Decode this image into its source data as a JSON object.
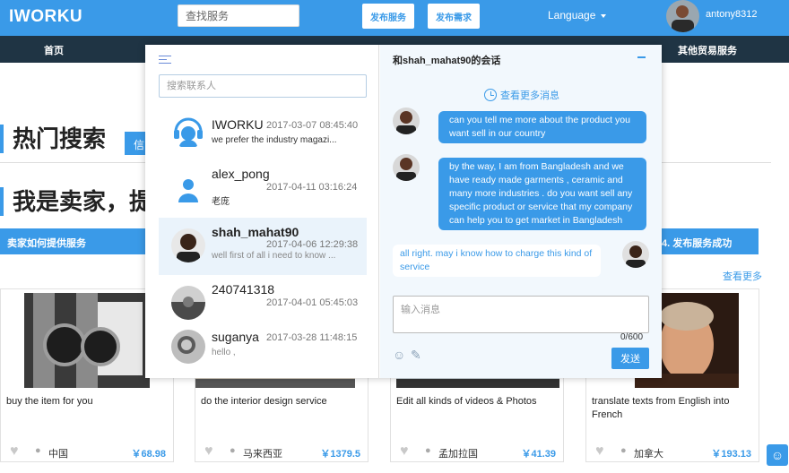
{
  "header": {
    "logo": "IWORKU",
    "search_placeholder": "查找服务",
    "publish_service": "发布服务",
    "publish_demand": "发布需求",
    "language": "Language",
    "username": "antony8312"
  },
  "nav": {
    "items": [
      "首页",
      "其他贸易服务"
    ]
  },
  "page": {
    "hot_search_title": "热门搜索",
    "hot_tag_partial": "信",
    "seller_title_partial": "我是卖家，提",
    "seller_howto": "卖家如何提供服务",
    "step4_partial": "4. 发布服务成功",
    "view_more": "查看更多"
  },
  "cards": [
    {
      "title": "buy the item for you",
      "country": "中国",
      "price": "￥68.98"
    },
    {
      "title": "do the interior design service",
      "country": "马来西亚",
      "price": "￥1379.5"
    },
    {
      "title": "Edit all kinds of videos & Photos",
      "country": "孟加拉国",
      "price": "￥41.39"
    },
    {
      "title": "translate texts from English into French",
      "country": "加拿大",
      "price": "￥193.13"
    }
  ],
  "chat": {
    "contact_search_placeholder": "搜索联系人",
    "contacts": [
      {
        "name": "IWORKU",
        "time": "2017-03-07 08:45:40",
        "msg": "we prefer the industry magazi..."
      },
      {
        "name": "alex_pong",
        "time": "2017-04-11 03:16:24",
        "msg": "老庞"
      },
      {
        "name": "shah_mahat90",
        "time": "2017-04-06 12:29:38",
        "msg": "well first of all i need to know ..."
      },
      {
        "name": "240741318",
        "time": "2017-04-01 05:45:03",
        "msg": ""
      },
      {
        "name": "suganya",
        "time": "2017-03-28 11:48:15",
        "msg": "hello ,"
      }
    ],
    "conversation_title": "和shah_mahat90的会话",
    "history_link": "查看更多消息",
    "messages": [
      {
        "from": "me",
        "text": "can you tell me more about the product you want sell in our country"
      },
      {
        "from": "me",
        "text": "by the way, I am from Bangladesh and we have ready made garments , ceramic and many more industries . do you want sell any specific product or service that my company can help you to get market in Bangladesh"
      },
      {
        "from": "them",
        "text": "all right. may i know how to charge this kind of service"
      }
    ],
    "input_placeholder": "输入消息",
    "counter": "0/600",
    "send": "发送"
  }
}
